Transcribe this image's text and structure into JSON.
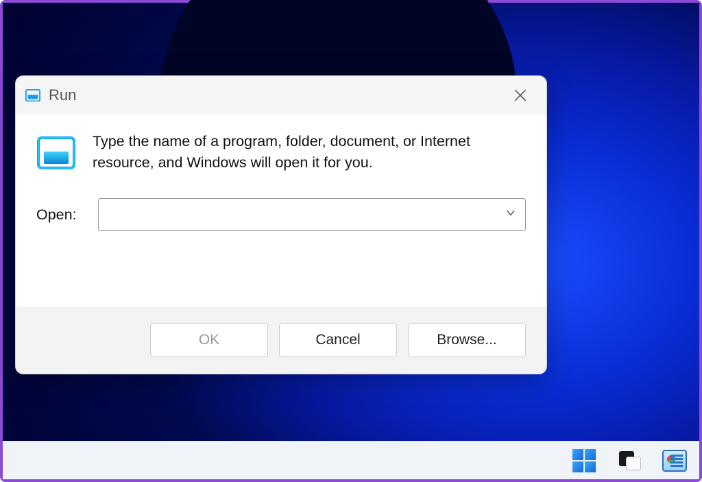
{
  "dialog": {
    "title": "Run",
    "description": "Type the name of a program, folder, document, or Internet resource, and Windows will open it for you.",
    "open_label": "Open:",
    "open_value": "",
    "buttons": {
      "ok": "OK",
      "cancel": "Cancel",
      "browse": "Browse..."
    }
  },
  "taskbar": {
    "items": [
      "start",
      "task-view",
      "resource-monitor"
    ]
  }
}
